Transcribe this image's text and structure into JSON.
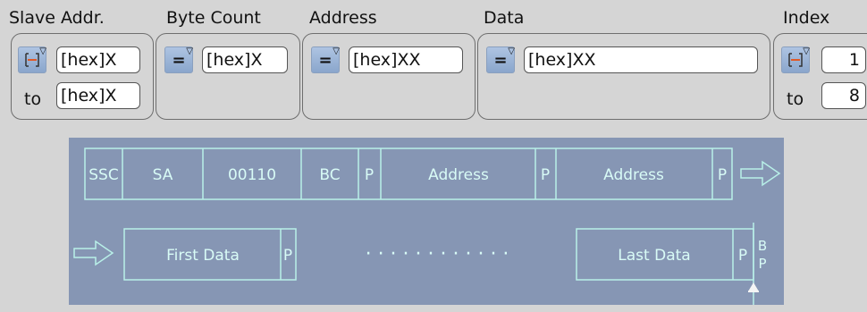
{
  "headers": {
    "slave_addr": "Slave Addr.",
    "byte_count": "Byte Count",
    "address": "Address",
    "data": "Data",
    "index": "Index"
  },
  "slave_addr": {
    "operator": "range",
    "from": "[hex]X",
    "to_label": "to",
    "to": "[hex]X"
  },
  "byte_count": {
    "operator": "=",
    "value": "[hex]X"
  },
  "address": {
    "operator": "=",
    "value": "[hex]XX"
  },
  "data": {
    "operator": "=",
    "value": "[hex]XX"
  },
  "index": {
    "operator": "range",
    "from": "1",
    "to_label": "to",
    "to": "8"
  },
  "frame_diagram": {
    "row1": [
      "SSC",
      "SA",
      "00110",
      "BC",
      "P",
      "Address",
      "P",
      "Address",
      "P"
    ],
    "row2": [
      "First Data",
      "P",
      "Last Data",
      "P",
      "B",
      "P"
    ],
    "dots": "· · · · · · · · · · · ·"
  },
  "colors": {
    "background": "#d5d5d5",
    "diagram_bg": "#8696b4",
    "diagram_stroke": "#b8f0e8",
    "operator_button": "#9bb3d6",
    "range_icon": "#e05a28"
  }
}
